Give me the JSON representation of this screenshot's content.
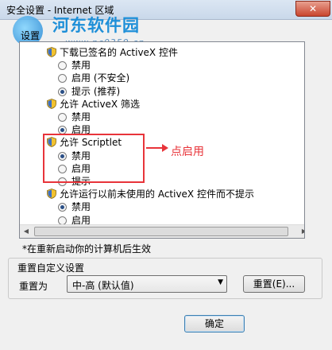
{
  "window": {
    "title": "安全设置 - Internet 区域",
    "close_glyph": "✕"
  },
  "watermark": {
    "site_name": "河东软件园",
    "url": "www.pc0359.cn"
  },
  "settings_label": "设置",
  "list": {
    "rows": [
      {
        "kind": "heading",
        "label": "下载已签名的 ActiveX 控件"
      },
      {
        "kind": "option",
        "label": "禁用",
        "selected": false
      },
      {
        "kind": "option",
        "label": "启用 (不安全)",
        "selected": false
      },
      {
        "kind": "option",
        "label": "提示 (推荐)",
        "selected": true
      },
      {
        "kind": "heading",
        "label": "允许 ActiveX 筛选"
      },
      {
        "kind": "option",
        "label": "禁用",
        "selected": false
      },
      {
        "kind": "option",
        "label": "启用",
        "selected": true
      },
      {
        "kind": "heading",
        "label": "允许 Scriptlet"
      },
      {
        "kind": "option",
        "label": "禁用",
        "selected": true
      },
      {
        "kind": "option",
        "label": "启用",
        "selected": false
      },
      {
        "kind": "option",
        "label": "提示",
        "selected": false
      },
      {
        "kind": "heading",
        "label": "允许运行以前未使用的 ActiveX 控件而不提示"
      },
      {
        "kind": "option",
        "label": "禁用",
        "selected": true
      },
      {
        "kind": "option",
        "label": "启用",
        "selected": false
      }
    ]
  },
  "annotation": {
    "text": "点启用"
  },
  "note": "*在重新启动你的计算机后生效",
  "reset_group": {
    "title": "重置自定义设置",
    "reset_to_label": "重置为",
    "select_value": "中-高 (默认值)",
    "reset_button": "重置(E)..."
  },
  "ok_button": "确定",
  "colors": {
    "highlight": "#e8343a",
    "watermark": "#1e8fd8"
  }
}
